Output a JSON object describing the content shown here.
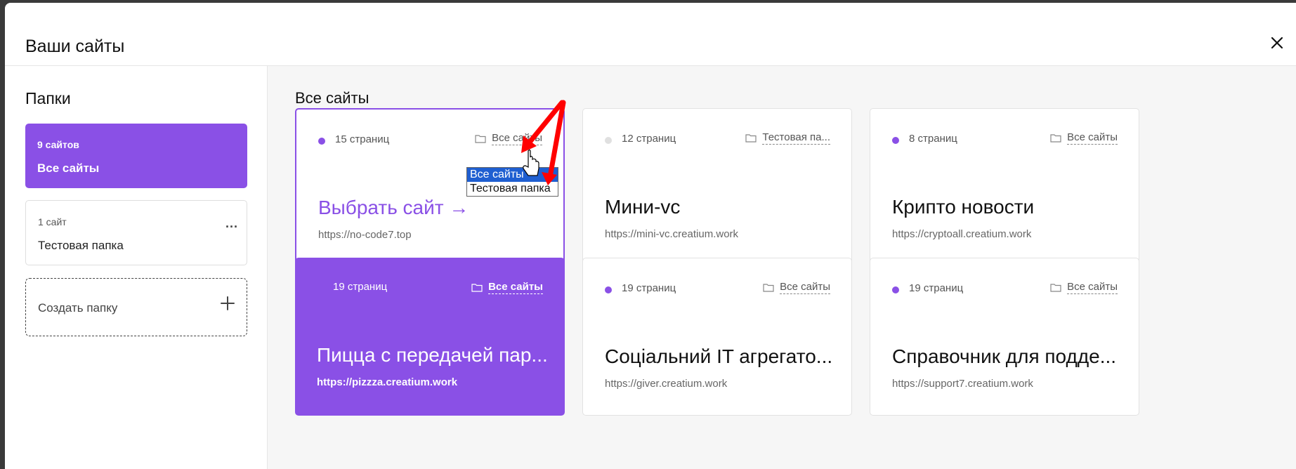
{
  "modal": {
    "title": "Ваши сайты"
  },
  "sidebar": {
    "title": "Папки",
    "folders": [
      {
        "count": "9 сайтов",
        "name": "Все сайты"
      },
      {
        "count": "1 сайт",
        "name": "Тестовая папка",
        "more": "..."
      }
    ],
    "create_label": "Создать папку"
  },
  "main": {
    "title": "Все сайты",
    "cards": [
      {
        "pages": "15 страниц",
        "folder": "Все сайты",
        "title": "Выбрать сайт →",
        "url": "https://no-code7.top"
      },
      {
        "pages": "12 страниц",
        "folder": "Тестовая па...",
        "title": "Мини-vc",
        "url": "https://mini-vc.creatium.work"
      },
      {
        "pages": "8 страниц",
        "folder": "Все сайты",
        "title": "Крипто новости",
        "url": "https://cryptoall.creatium.work"
      },
      {
        "pages": "19 страниц",
        "folder": "Все сайты",
        "title": "Пицца с передачей пар...",
        "url": "https://pizzza.creatium.work"
      },
      {
        "pages": "19 страниц",
        "folder": "Все сайты",
        "title": "Соціальний IT агрегато...",
        "url": "https://giver.creatium.work"
      },
      {
        "pages": "19 страниц",
        "folder": "Все сайты",
        "title": "Справочник для подде...",
        "url": "https://support7.creatium.work"
      }
    ]
  },
  "dropdown": {
    "options": [
      "Все сайты",
      "Тестовая папка"
    ]
  },
  "colors": {
    "accent": "#8a50e6",
    "select_highlight": "#1f5fd1",
    "annotation_arrow": "#ff0000"
  }
}
